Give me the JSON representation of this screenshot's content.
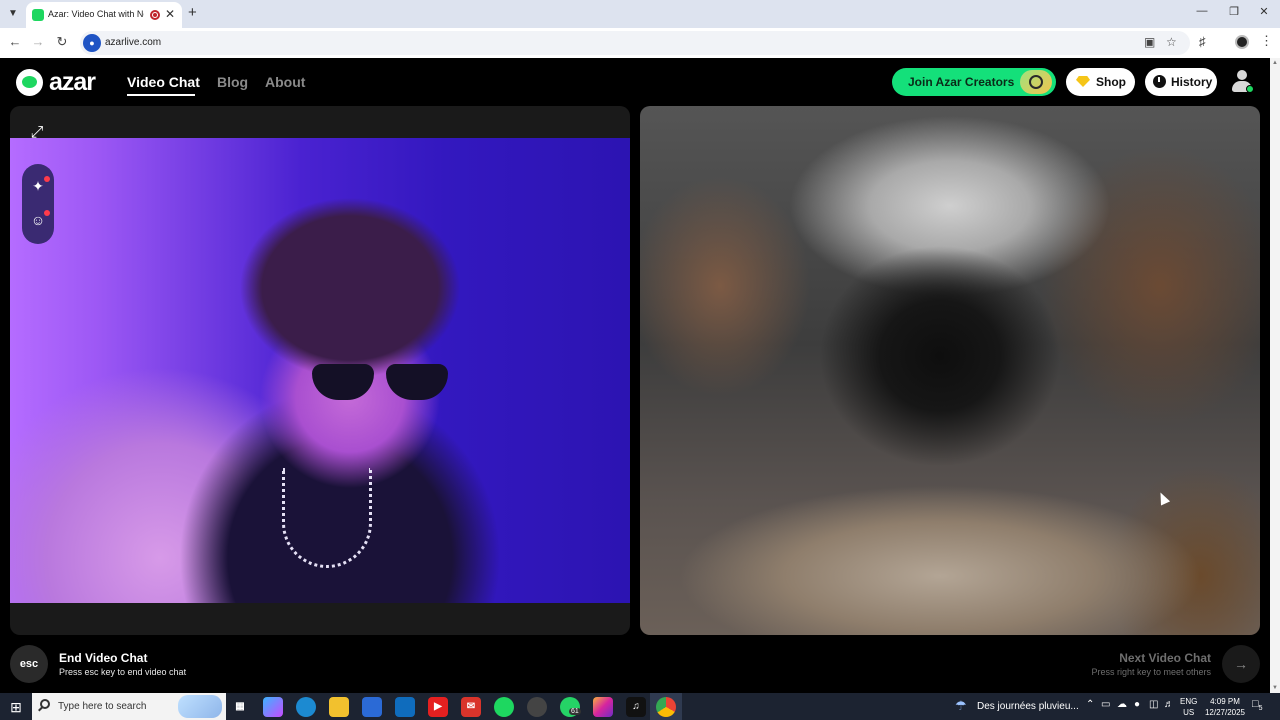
{
  "browser": {
    "tab_title": "Azar: Video Chat with New",
    "url": "azarlive.com",
    "tab_list_icon": "chevron-down-icon",
    "close_tab_icon": "close-icon",
    "new_tab_icon": "plus-icon",
    "back_icon": "back-arrow-icon",
    "forward_icon": "forward-arrow-icon",
    "reload_icon": "reload-icon",
    "minimize_icon": "minimize-icon",
    "restore_icon": "restore-icon",
    "close_window_icon": "close-icon",
    "install_icon": "install-app-icon",
    "bookmark_icon": "star-icon",
    "extensions_icon": "puzzle-icon",
    "menu_icon": "kebab-icon"
  },
  "header": {
    "logo_text": "azar",
    "nav": [
      {
        "label": "Video Chat",
        "active": true
      },
      {
        "label": "Blog",
        "active": false
      },
      {
        "label": "About",
        "active": false
      }
    ],
    "creators_label": "Join Azar Creators",
    "shop_label": "Shop",
    "history_label": "History"
  },
  "colors": {
    "brand_green": "#1ed760",
    "creators_green": "#14e07a",
    "page_bg": "#000000",
    "panel_bg": "#1a1a1a",
    "gem_yellow": "#f5c518"
  },
  "controls": {
    "esc_key": "esc",
    "end_title": "End Video Chat",
    "end_sub": "Press esc key to end video chat",
    "next_title": "Next Video Chat",
    "next_sub": "Press right key to meet others"
  },
  "taskbar": {
    "search_placeholder": "Type here to search",
    "badge_count": "61",
    "weather": "Des journées pluvieu...",
    "lang_line1": "ENG",
    "lang_line2": "US",
    "time": "4:09 PM",
    "date": "12/27/2025",
    "notifications": "5",
    "apps": [
      "task-view-icon",
      "copilot-icon",
      "edge-icon",
      "file-explorer-icon",
      "store-icon",
      "outlook-icon",
      "youtube-icon",
      "mail-icon",
      "spotify-icon",
      "app-icon",
      "whatsapp-icon",
      "instagram-icon",
      "tiktok-icon",
      "chrome-icon"
    ]
  }
}
